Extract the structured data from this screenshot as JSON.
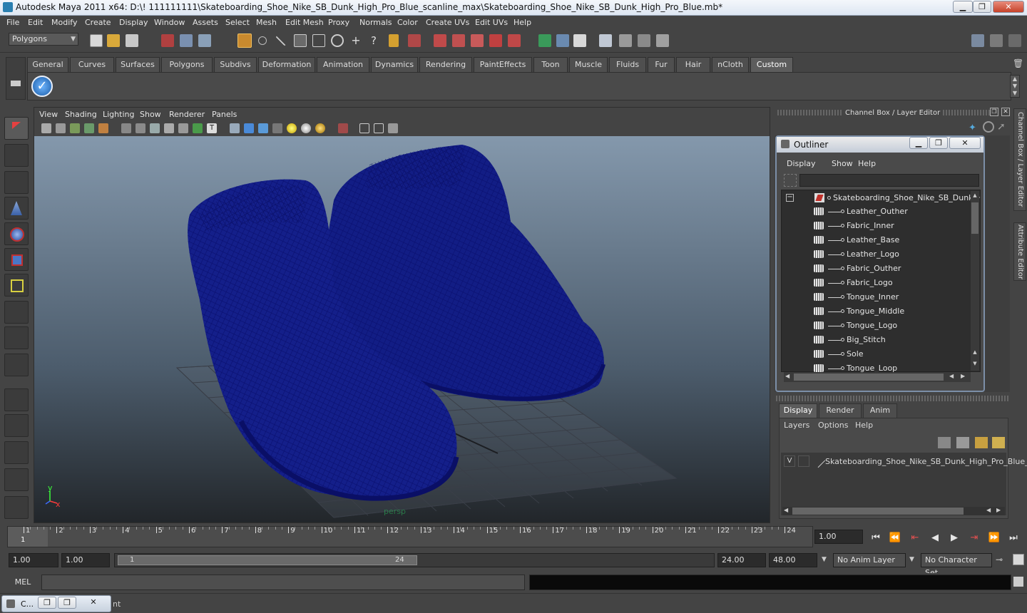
{
  "window": {
    "title": "Autodesk Maya 2011 x64: D:\\! 111111111\\Skateboarding_Shoe_Nike_SB_Dunk_High_Pro_Blue_scanline_max\\Skateboarding_Shoe_Nike_SB_Dunk_High_Pro_Blue.mb*",
    "min": "▁",
    "max": "❐",
    "close": "✕"
  },
  "menubar": [
    "File",
    "Edit",
    "Modify",
    "Create",
    "Display",
    "Window",
    "Assets",
    "Select",
    "Mesh",
    "Edit Mesh",
    "Proxy",
    "Normals",
    "Color",
    "Create UVs",
    "Edit UVs",
    "Help"
  ],
  "statusline": {
    "mode": "Polygons"
  },
  "shelf": {
    "tabs": [
      "General",
      "Curves",
      "Surfaces",
      "Polygons",
      "Subdivs",
      "Deformation",
      "Animation",
      "Dynamics",
      "Rendering",
      "PaintEffects",
      "Toon",
      "Muscle",
      "Fluids",
      "Fur",
      "Hair",
      "nCloth",
      "Custom"
    ],
    "active": "Custom",
    "check": "✓"
  },
  "viewport": {
    "menu": [
      "View",
      "Shading",
      "Lighting",
      "Show",
      "Renderer",
      "Panels"
    ],
    "camera": "persp",
    "axis_y": "y",
    "axis_x": "x",
    "wire_color": "#101c7a"
  },
  "channel_box": {
    "title": "Channel Box / Layer Editor"
  },
  "outliner": {
    "title": "Outliner",
    "menu": [
      "Display",
      "Show",
      "Help"
    ],
    "root": "Skateboarding_Shoe_Nike_SB_Dunk_H",
    "collapse": "−",
    "items": [
      "Leather_Outher",
      "Fabric_Inner",
      "Leather_Base",
      "Leather_Logo",
      "Fabric_Outher",
      "Fabric_Logo",
      "Tongue_Inner",
      "Tongue_Middle",
      "Tongue_Logo",
      "Big_Stitch",
      "Sole",
      "Tongue_Loop"
    ]
  },
  "layer_editor": {
    "tabs": [
      "Display",
      "Render",
      "Anim"
    ],
    "active": "Display",
    "menu": [
      "Layers",
      "Options",
      "Help"
    ],
    "layer_v": "V",
    "layer_name": "Skateboarding_Shoe_Nike_SB_Dunk_High_Pro_Blue_"
  },
  "side_tabs": [
    "Channel Box / Layer Editor",
    "Attribute Editor"
  ],
  "timeline": {
    "ticks": [
      "1",
      "2",
      "3",
      "4",
      "5",
      "6",
      "7",
      "8",
      "9",
      "10",
      "11",
      "12",
      "13",
      "14",
      "15",
      "16",
      "17",
      "18",
      "19",
      "20",
      "21",
      "22",
      "23",
      "24"
    ],
    "current": "1",
    "current_field": "1.00"
  },
  "playback": [
    "⏮",
    "⏪",
    "⇤",
    "◀",
    "▶",
    "⇥",
    "⏩",
    "⏭"
  ],
  "range": {
    "start": "1.00",
    "start2": "1.00",
    "slider_start": "1",
    "slider_end": "24",
    "end": "24.00",
    "end2": "48.00",
    "anim_layer": "No Anim Layer",
    "char_set": "No Character Set"
  },
  "cmdline": {
    "label": "MEL"
  },
  "minimized": {
    "label": "C...",
    "tail": "nt"
  }
}
